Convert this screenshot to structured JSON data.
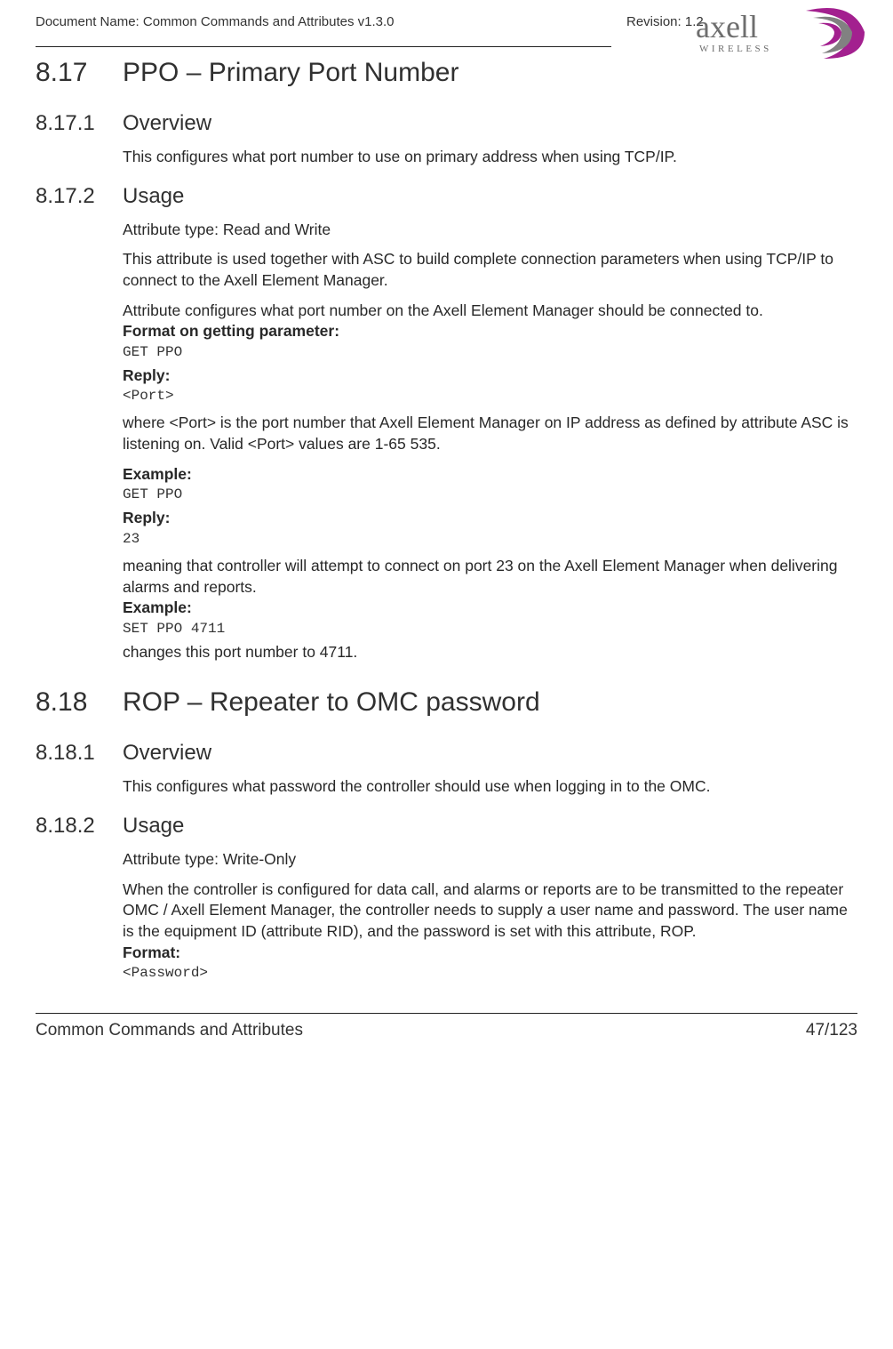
{
  "header": {
    "doc_name": "Document Name: Common Commands and Attributes v1.3.0",
    "revision": "Revision: 1.2",
    "logo_text": "axell",
    "logo_sub": "WIRELESS"
  },
  "s817": {
    "num": "8.17",
    "title": "PPO – Primary Port Number",
    "s1": {
      "num": "8.17.1",
      "title": "Overview",
      "p1": "This configures what port number to use on primary address when using TCP/IP."
    },
    "s2": {
      "num": "8.17.2",
      "title": "Usage",
      "p1": "Attribute type: Read and Write",
      "p2": "This attribute is used together with ASC to build complete connection parameters when  using TCP/IP to connect to the Axell Element Manager.",
      "p3": "Attribute configures what port number on the Axell Element Manager should be connected to.",
      "fmt_get_label": "Format on getting parameter:",
      "fmt_get_code": "GET PPO",
      "reply1_label": "Reply:",
      "reply1_code": "<Port>",
      "p4": "where <Port> is the port number that Axell Element Manager on IP address as defined by attribute ASC is listening on.  Valid <Port> values are 1-65 535.",
      "ex1_label": "Example:",
      "ex1_code": "GET PPO",
      "reply2_label": "Reply:",
      "reply2_code": "23",
      "p5": "meaning that controller will attempt to connect on port 23 on the Axell Element Manager when delivering alarms and reports.",
      "ex2_label": "Example:",
      "ex2_code": "SET PPO 4711",
      "p6": "changes this port number to 4711."
    }
  },
  "s818": {
    "num": "8.18",
    "title": "ROP – Repeater to OMC password",
    "s1": {
      "num": "8.18.1",
      "title": "Overview",
      "p1": "This configures what password the controller should use when logging in to the OMC."
    },
    "s2": {
      "num": "8.18.2",
      "title": "Usage",
      "p1": "Attribute type: Write-Only",
      "p2": "When the controller is configured for data call, and alarms or reports are to be transmitted to the repeater OMC / Axell Element Manager, the controller needs to supply a user name and password. The user name is the equipment ID (attribute RID), and the password is set with this attribute, ROP.",
      "fmt_label": "Format:",
      "fmt_code": "<Password>"
    }
  },
  "footer": {
    "left": "Common Commands and Attributes",
    "right": "47/123"
  }
}
